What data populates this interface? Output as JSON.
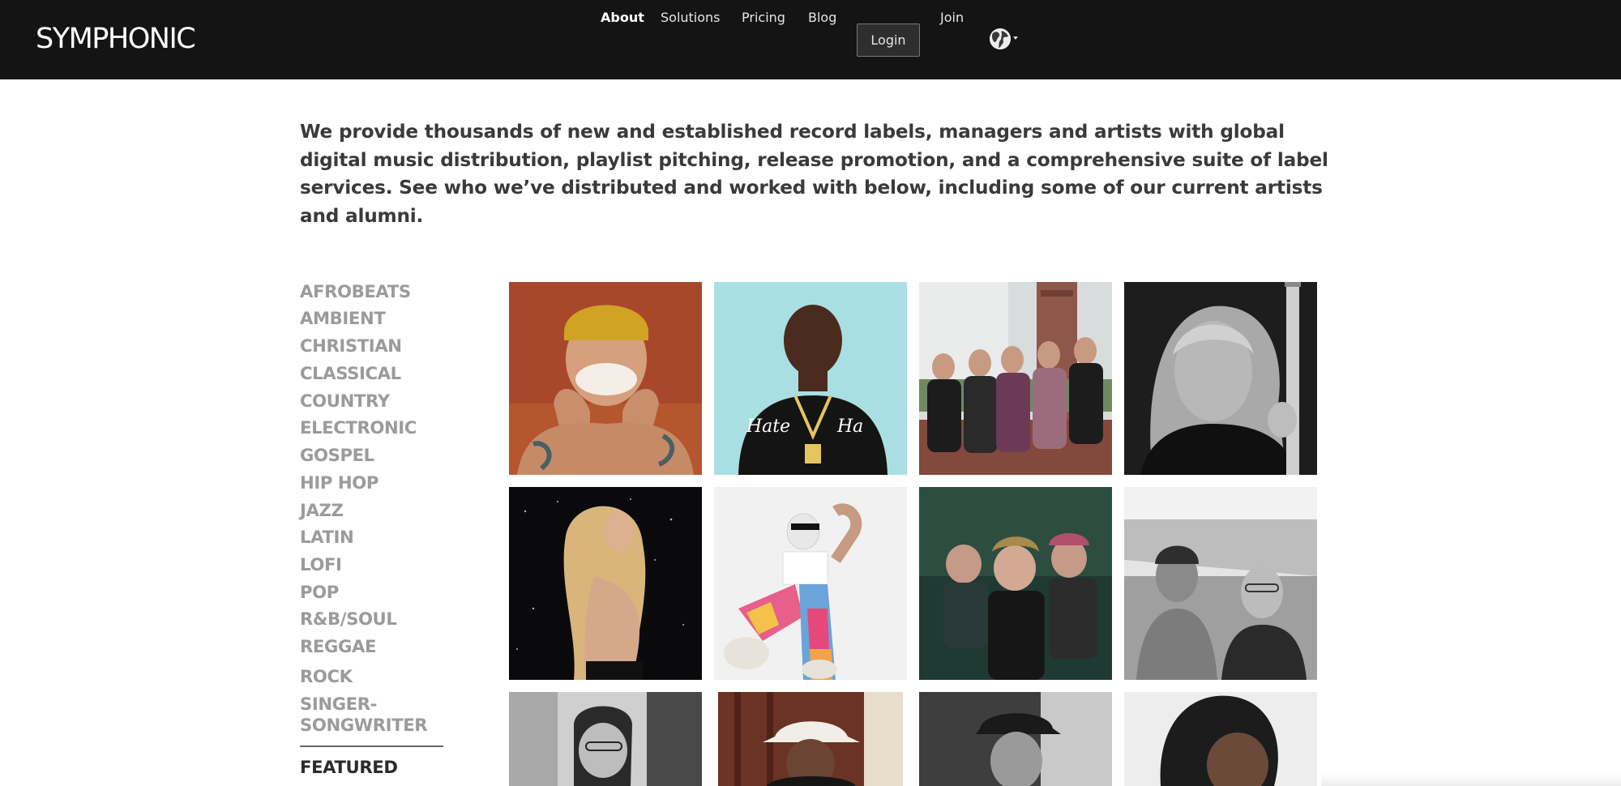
{
  "header": {
    "logo": "SYMPHONIC",
    "nav": {
      "about": "About",
      "solutions": "Solutions",
      "pricing": "Pricing",
      "blog": "Blog",
      "login": "Login",
      "join": "Join"
    },
    "language_icon": "globe-icon"
  },
  "intro": {
    "text": "We provide thousands of new and established record labels, managers and artists with global digital music distribution, playlist pitching, release promotion, and a comprehensive suite of label services. See who we’ve distributed and worked with below, including some of our current artists and alumni."
  },
  "genres": {
    "items": [
      "AFROBEATS",
      "AMBIENT",
      "CHRISTIAN",
      "CLASSICAL",
      "COUNTRY",
      "ELECTRONIC",
      "GOSPEL",
      "HIP HOP",
      "JAZZ",
      "LATIN",
      "LOFI",
      "POP",
      "R&B/SOUL",
      "REGGAE",
      "ROCK",
      "SINGER-",
      "SONGWRITER"
    ],
    "featured": "FEATURED"
  },
  "colors": {
    "navbar": "#141414",
    "genre_text": "#9b9b9b",
    "featured_text": "#2b2b2b"
  }
}
